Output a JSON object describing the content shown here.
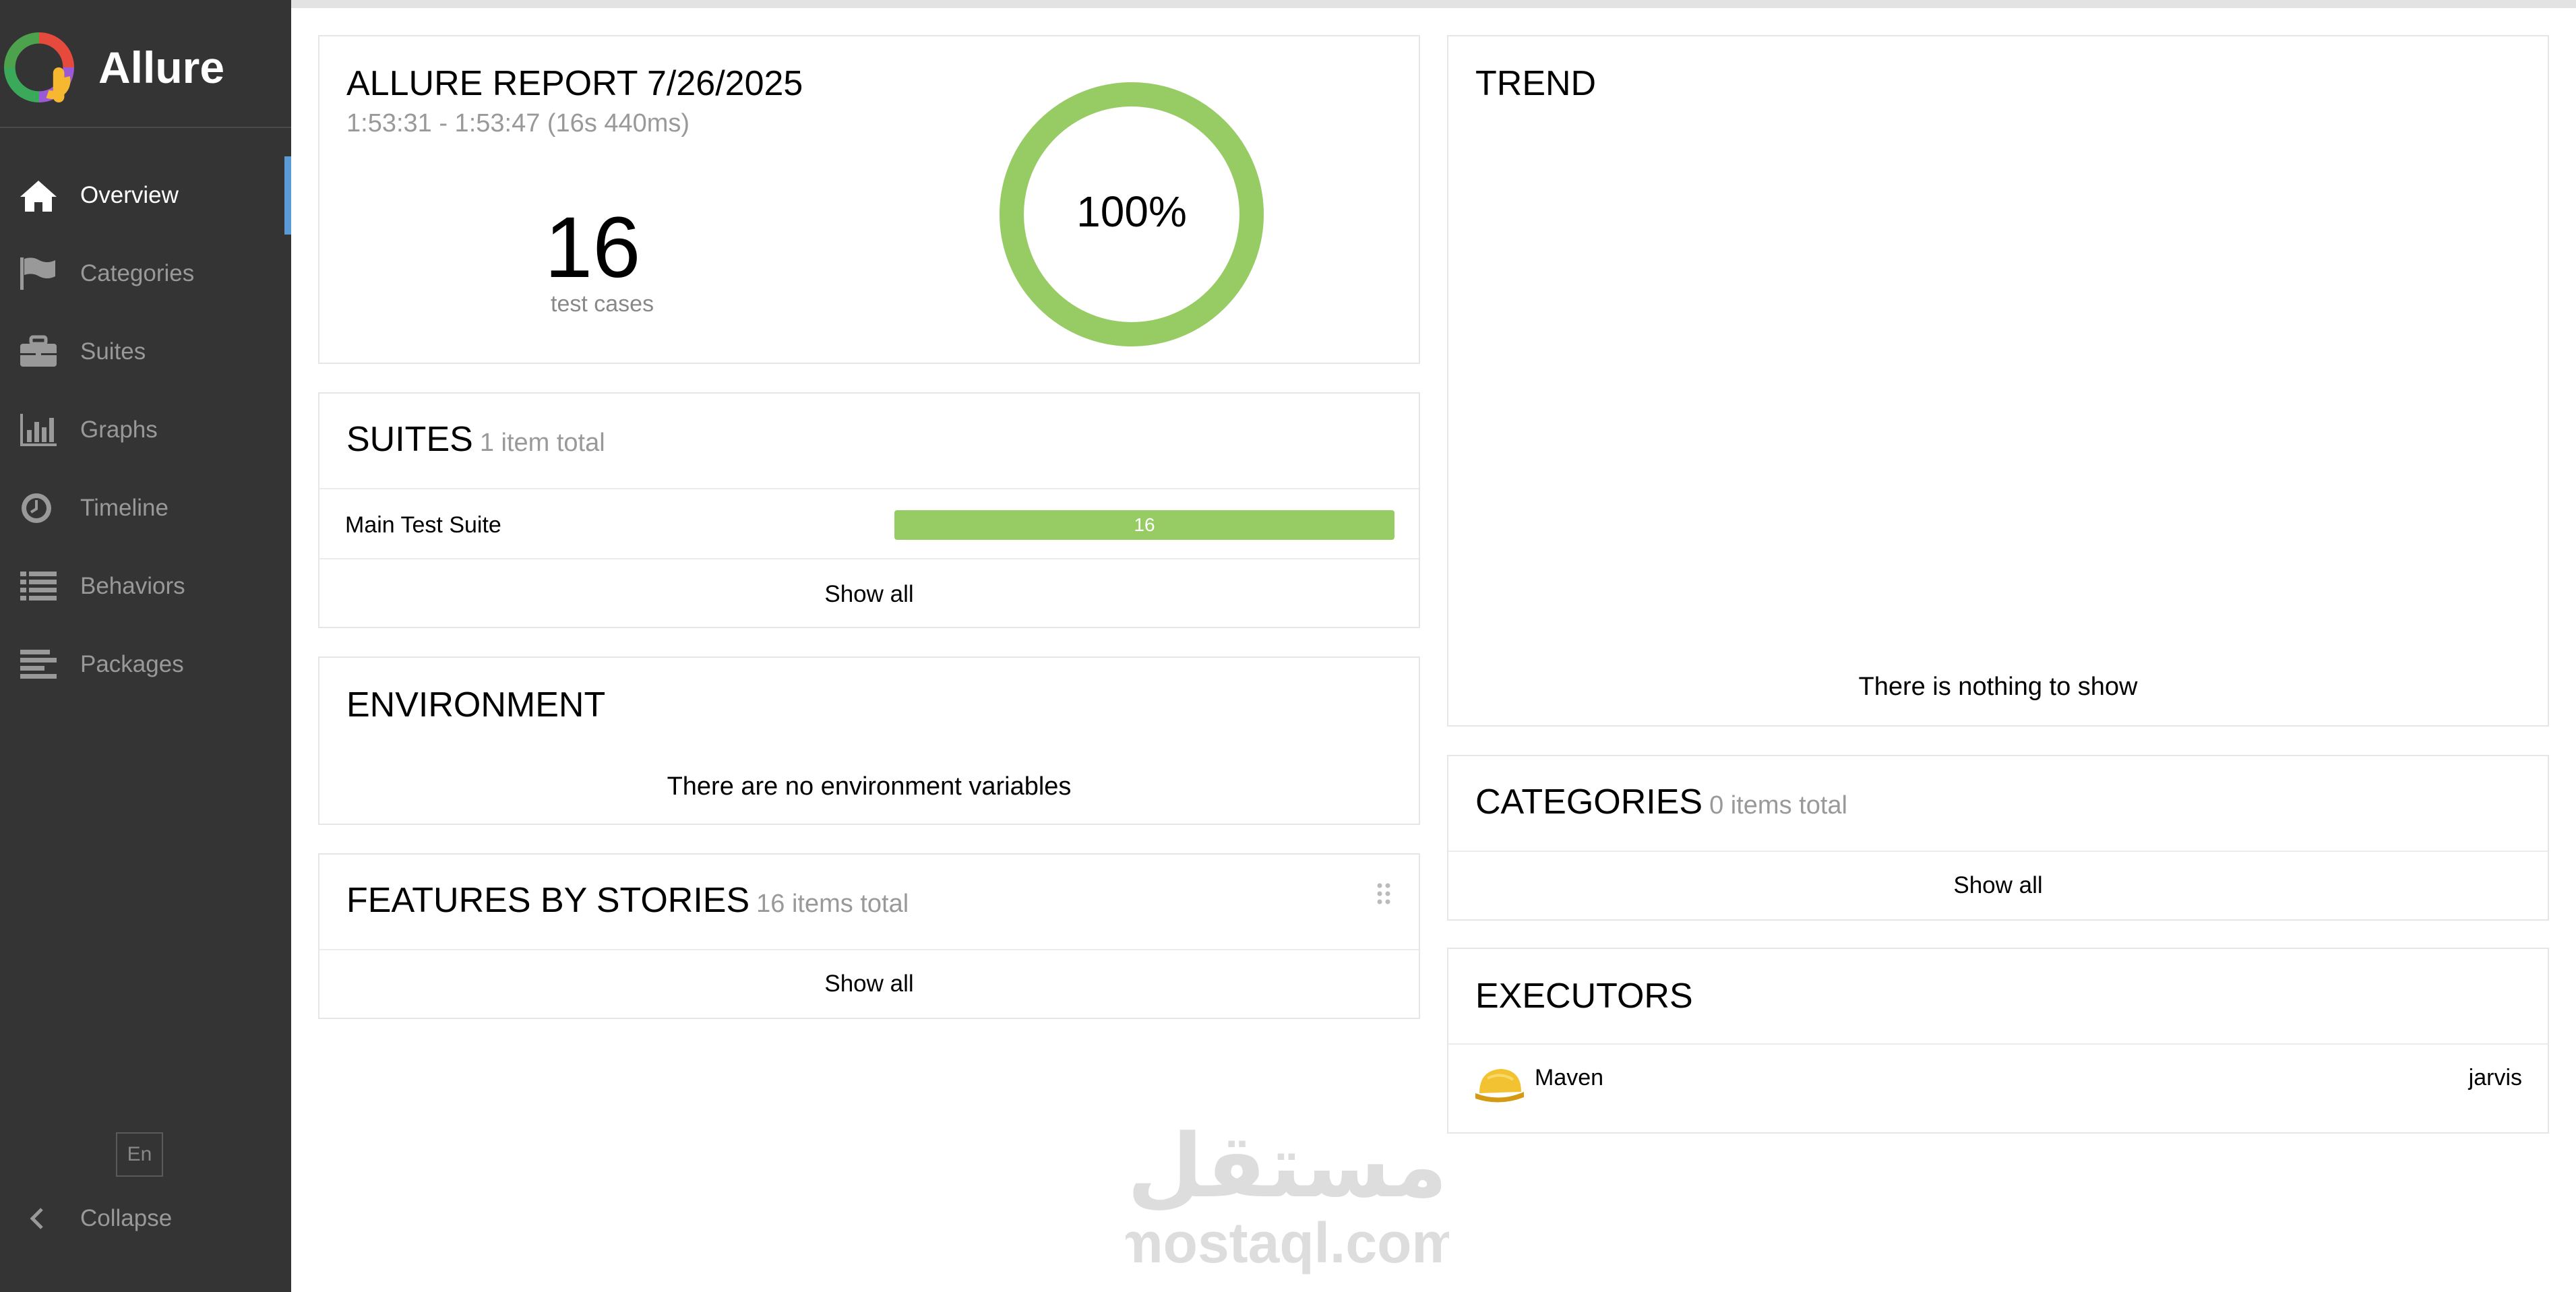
{
  "sidebar": {
    "brand": "Allure",
    "items": [
      {
        "label": "Overview",
        "icon": "home-icon",
        "active": true
      },
      {
        "label": "Categories",
        "icon": "flag-icon"
      },
      {
        "label": "Suites",
        "icon": "briefcase-icon"
      },
      {
        "label": "Graphs",
        "icon": "bar-chart-icon"
      },
      {
        "label": "Timeline",
        "icon": "clock-icon"
      },
      {
        "label": "Behaviors",
        "icon": "list-icon"
      },
      {
        "label": "Packages",
        "icon": "align-left-icon"
      }
    ],
    "language": "En",
    "collapse_label": "Collapse"
  },
  "summary": {
    "title": "ALLURE REPORT 7/26/2025",
    "time_range": "1:53:31 - 1:53:47 (16s 440ms)",
    "test_count": "16",
    "test_count_label": "test cases",
    "pass_rate_label": "100%",
    "pass_rate": 1.0,
    "pass_color": "#97cc64"
  },
  "suites": {
    "title": "SUITES",
    "total": "1 item total",
    "rows": [
      {
        "name": "Main Test Suite",
        "passed": "16"
      }
    ],
    "show_all": "Show all"
  },
  "environment": {
    "title": "ENVIRONMENT",
    "empty_text": "There are no environment variables"
  },
  "features": {
    "title": "FEATURES BY STORIES",
    "total": "16 items total",
    "show_all": "Show all"
  },
  "trend": {
    "title": "TREND",
    "empty_text": "There is nothing to show"
  },
  "categories": {
    "title": "CATEGORIES",
    "total": "0 items total",
    "show_all": "Show all"
  },
  "executors": {
    "title": "EXECUTORS",
    "rows": [
      {
        "name": "Maven",
        "build": "jarvis",
        "icon": "hard-hat-icon"
      }
    ]
  },
  "watermark": {
    "arabic": "مستقل",
    "latin": "mostaql.com"
  }
}
